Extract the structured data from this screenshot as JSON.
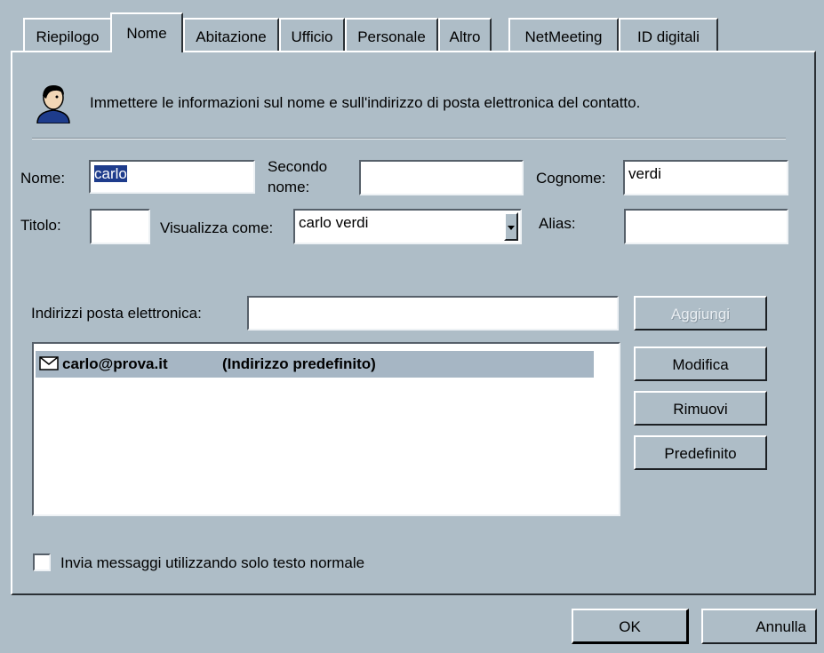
{
  "tabs": [
    "Riepilogo",
    "Nome",
    "Abitazione",
    "Ufficio",
    "Personale",
    "Altro",
    "NetMeeting",
    "ID digitali"
  ],
  "intro_text": "Immettere le informazioni sul nome e sull'indirizzo di posta elettronica del contatto.",
  "form": {
    "nome_label": "Nome:",
    "nome_value": "carlo",
    "secondo_nome_label_line1": "Secondo",
    "secondo_nome_label_line2": "nome:",
    "secondo_nome_value": "",
    "cognome_label": "Cognome:",
    "cognome_value": "verdi",
    "titolo_label": "Titolo:",
    "titolo_value": "",
    "visualizza_label": "Visualizza come:",
    "visualizza_value": "carlo verdi",
    "alias_label": "Alias:",
    "alias_value": ""
  },
  "email": {
    "label": "Indirizzi posta elettronica:",
    "input_value": "",
    "add_button": "Aggiungi",
    "list": [
      {
        "address": "carlo@prova.it",
        "note": "(Indirizzo predefinito)"
      }
    ],
    "modify_button": "Modifica",
    "remove_button": "Rimuovi",
    "default_button": "Predefinito"
  },
  "plain_text_checkbox": {
    "label": "Invia messaggi utilizzando solo testo normale",
    "checked": false
  },
  "footer": {
    "ok_button": "OK",
    "cancel_button": "Annulla"
  },
  "colors": {
    "dialog_bg": "#aebdc7",
    "selection": "#a6b6c4",
    "accent": "#1e3c8c"
  },
  "icons": {
    "contact": "contact-person-icon",
    "email_item": "envelope-icon",
    "dropdown": "dropdown-arrow-icon"
  }
}
